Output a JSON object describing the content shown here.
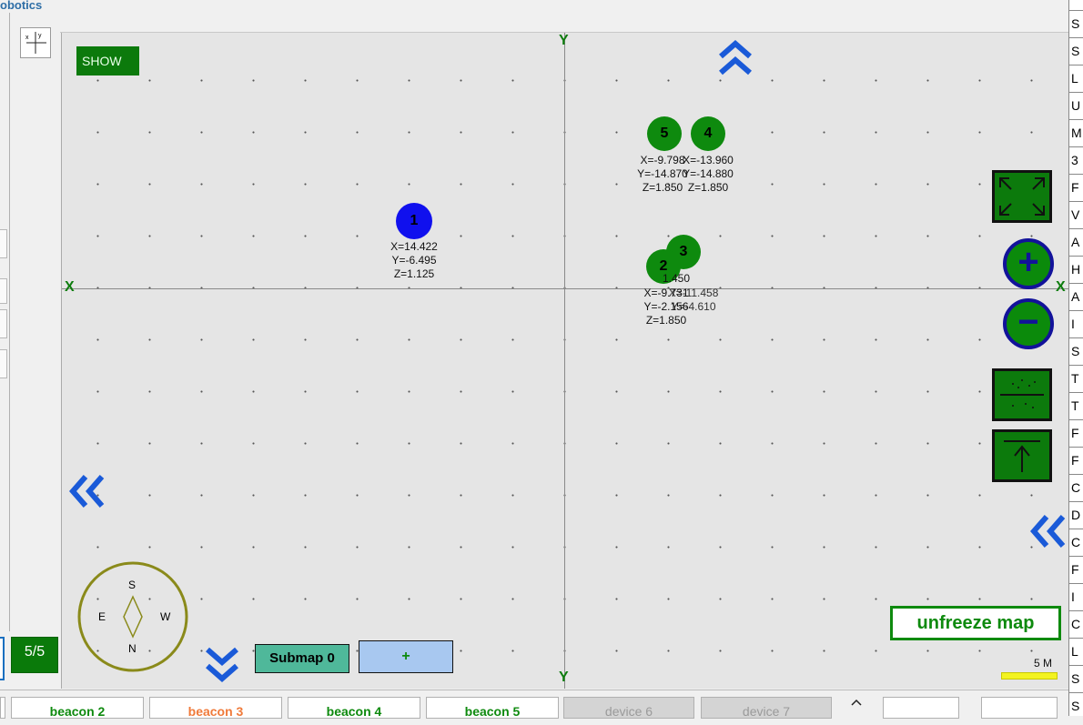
{
  "app": {
    "brand": "obotics"
  },
  "left": {
    "count_badge": "5/5"
  },
  "map": {
    "show_label": "SHOW",
    "axes": {
      "x": "X",
      "y": "Y"
    },
    "beacons": [
      {
        "id": "1",
        "color": "#1010ee",
        "x": "X=14.422",
        "y": "Y=-6.495",
        "z": "Z=1.125"
      },
      {
        "id": "2",
        "color": "#0e8a0e",
        "x": "X=-9.731",
        "y": "Y=-2.156",
        "z": "Z=1.850"
      },
      {
        "id": "3",
        "color": "#0e8a0e",
        "x": "X=-11.458",
        "y": "Y=-4.610",
        "z": ""
      },
      {
        "id": "4",
        "color": "#0e8a0e",
        "x": "X=-13.960",
        "y": "Y=-14.880",
        "z": "Z=1.850"
      },
      {
        "id": "5",
        "color": "#0e8a0e",
        "x": "X=-9.798",
        "y": "Y=-14.870",
        "z": "Z=1.850"
      }
    ],
    "beacon3_top_label": "1.450",
    "unfreeze_label": "unfreeze map",
    "scale_label": "5 M",
    "submap_label": "Submap 0",
    "add_label": "+",
    "compass": {
      "n": "N",
      "s": "S",
      "e": "E",
      "w": "W"
    }
  },
  "right_list": [
    "S",
    "S",
    "L",
    "U",
    "M",
    "3",
    "F",
    "V",
    "A",
    "H",
    "A",
    "I",
    "S",
    "T",
    "T",
    "F",
    "F",
    "C",
    "D",
    "C",
    "F",
    "I",
    "C",
    "L",
    "S",
    "S"
  ],
  "tabs": [
    {
      "label": "beacon 2",
      "color": "#0e8a0e",
      "disabled": false
    },
    {
      "label": "beacon 3",
      "color": "#f07a3a",
      "disabled": false
    },
    {
      "label": "beacon 4",
      "color": "#0e8a0e",
      "disabled": false
    },
    {
      "label": "beacon 5",
      "color": "#0e8a0e",
      "disabled": false
    },
    {
      "label": "device 6",
      "color": "#9a9a9a",
      "disabled": true
    },
    {
      "label": "device 7",
      "color": "#9a9a9a",
      "disabled": true
    }
  ]
}
